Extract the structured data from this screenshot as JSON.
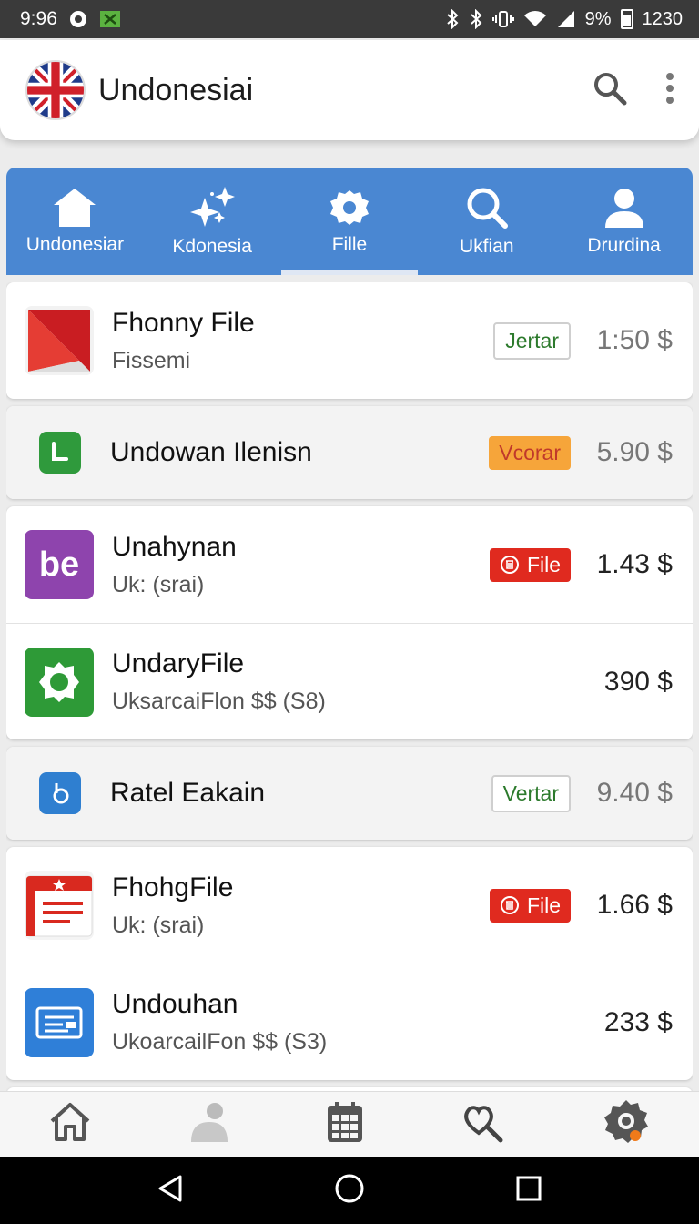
{
  "status_bar": {
    "time": "9:96",
    "battery_pct": "9%",
    "clock_right": "1230"
  },
  "app_bar": {
    "title": "Undonesiai",
    "icons": [
      "flag-icon",
      "search-icon",
      "more-vert-icon"
    ]
  },
  "tabs": [
    {
      "label": "Undonesiar",
      "icon": "home-icon",
      "active": false
    },
    {
      "label": "Kdonesia",
      "icon": "sparkles-icon",
      "active": false
    },
    {
      "label": "Fille",
      "icon": "gear-icon",
      "active": true
    },
    {
      "label": "Ukfian",
      "icon": "search-icon",
      "active": false
    },
    {
      "label": "Drurdina",
      "icon": "person-icon",
      "active": false
    }
  ],
  "list": {
    "items": [
      {
        "title": "Fhonny File",
        "subtitle": "Fissemi",
        "badge": "Jertar",
        "price": "1:50 $"
      },
      {
        "title": "Undowan Ilenisn",
        "badge": "Vcorar",
        "price": "5.90 $"
      },
      {
        "title": "Unahynan",
        "subtitle": "Uk: (srai)",
        "badge": "File",
        "price": "1.43 $",
        "icon_text": "be"
      },
      {
        "title": "UndaryFile",
        "subtitle": "UksarcaiFlon $$ (S8)",
        "price": "390 $"
      },
      {
        "title": "Ratel Eakain",
        "badge": "Vertar",
        "price": "9.40 $"
      },
      {
        "title": "FhohgFile",
        "subtitle": "Uk: (srai)",
        "badge": "File",
        "price": "1.66 $"
      },
      {
        "title": "Undouhan",
        "subtitle": "UkoarcailFon $$ (S3)",
        "price": "233 $"
      }
    ]
  },
  "bottom_nav": [
    "home-icon",
    "profile-icon",
    "calendar-icon",
    "search-heart-icon",
    "settings-icon"
  ],
  "system_nav": [
    "back-icon",
    "home-circle-icon",
    "recents-icon"
  ],
  "colors": {
    "tab_bar": "#4a87d2",
    "badge_red": "#e02a1f",
    "badge_orange": "#f6a53a"
  }
}
